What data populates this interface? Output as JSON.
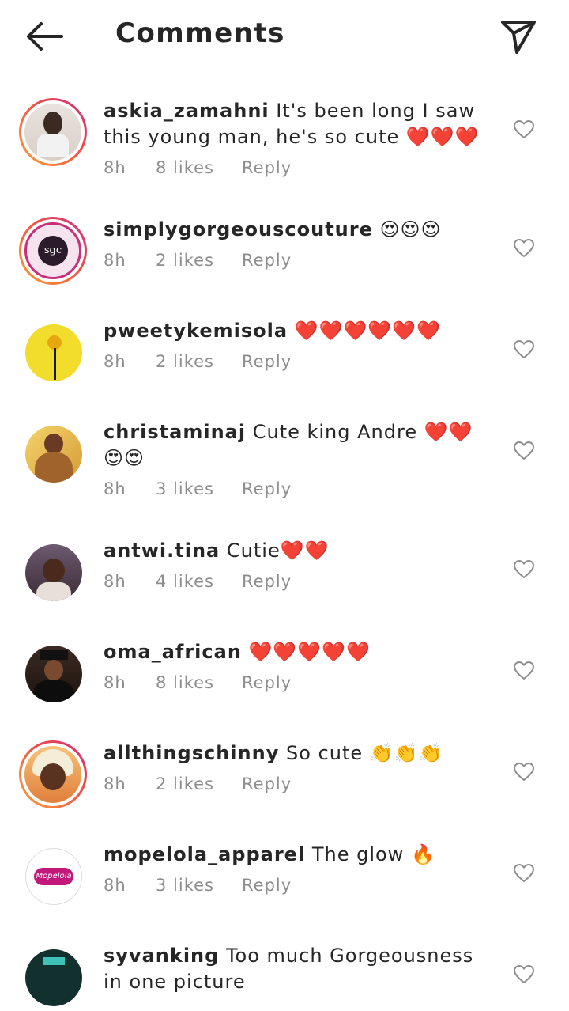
{
  "header": {
    "title": "Comments"
  },
  "comments": [
    {
      "username": "askia_zamahni",
      "text": "It's been long I saw this young man, he's so cute ❤️❤️❤️",
      "time": "8h",
      "likes": "8 likes",
      "reply": "Reply"
    },
    {
      "username": "simplygorgeouscouture",
      "text": "😍😍😍",
      "time": "8h",
      "likes": "2 likes",
      "reply": "Reply",
      "avatar_text": "sgc"
    },
    {
      "username": "pweetykemisola",
      "text": "❤️❤️❤️❤️❤️❤️",
      "time": "8h",
      "likes": "2 likes",
      "reply": "Reply"
    },
    {
      "username": "christaminaj",
      "text": "Cute king Andre ❤️❤️😍😍",
      "time": "8h",
      "likes": "3 likes",
      "reply": "Reply"
    },
    {
      "username": "antwi.tina",
      "text": "Cutie❤️❤️",
      "time": "8h",
      "likes": "4 likes",
      "reply": "Reply"
    },
    {
      "username": "oma_african",
      "text": "❤️❤️❤️❤️❤️",
      "time": "8h",
      "likes": "8 likes",
      "reply": "Reply"
    },
    {
      "username": "allthingschinny",
      "text": "So cute 👏👏👏",
      "time": "8h",
      "likes": "2 likes",
      "reply": "Reply"
    },
    {
      "username": "mopelola_apparel",
      "text": "The glow 🔥",
      "time": "8h",
      "likes": "3 likes",
      "reply": "Reply",
      "avatar_text": "Mopelola"
    },
    {
      "username": "syvanking",
      "text": "Too much Gorgeousness in one picture"
    }
  ]
}
